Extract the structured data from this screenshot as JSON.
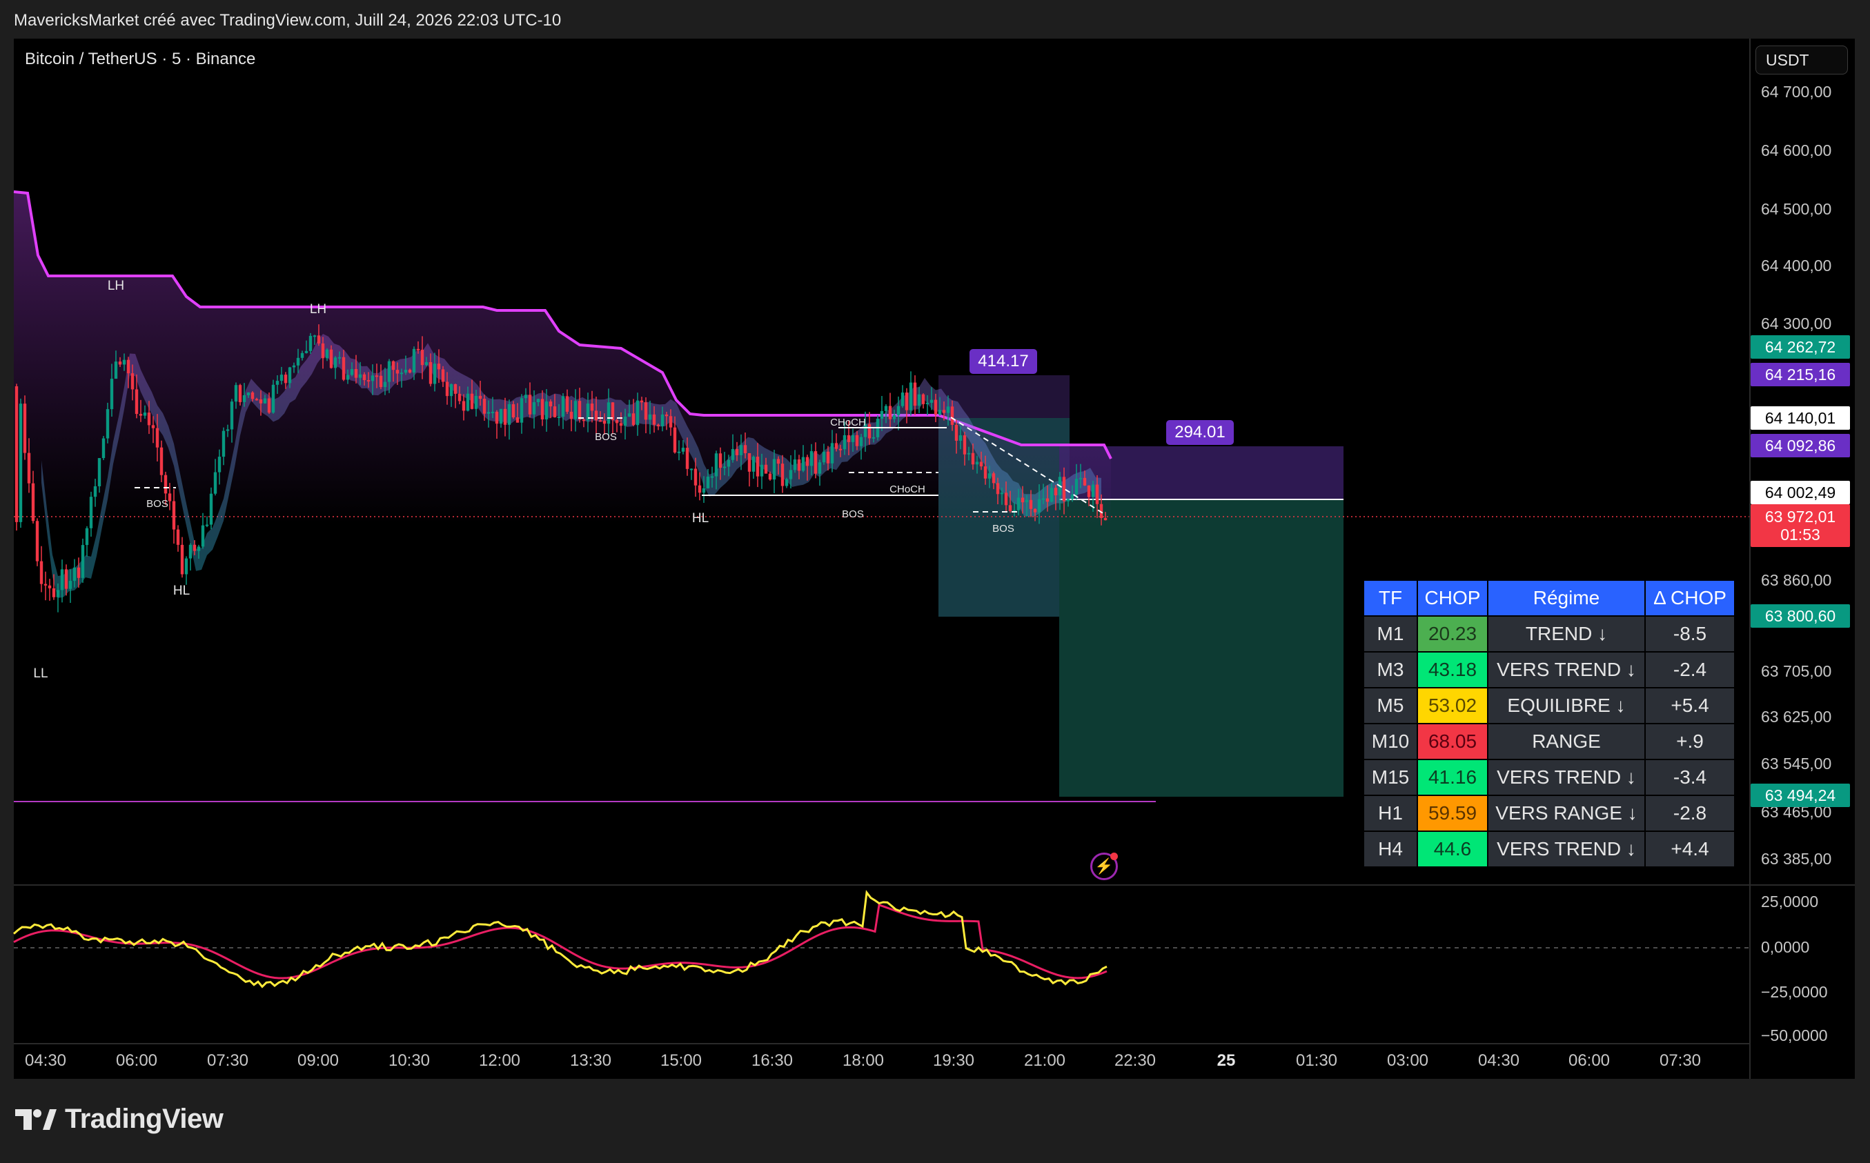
{
  "header": {
    "text": "MavericksMarket créé avec TradingView.com, Juill 24, 2026 22:03 UTC-10"
  },
  "symbol": {
    "title": "Bitcoin / TetherUS · 5 · Binance"
  },
  "currency_button": "USDT",
  "price_ticks": [
    "64 700,00",
    "64 600,00",
    "64 500,00",
    "64 400,00",
    "64 300,00",
    "63 860,00",
    "63 705,00",
    "63 625,00",
    "63 545,00",
    "63 465,00",
    "63 385,00"
  ],
  "price_labels": [
    {
      "text": "64 262,72",
      "bg": "#089981",
      "fg": "#ffffff"
    },
    {
      "text": "64 215,16",
      "bg": "#6a2fc5",
      "fg": "#ffffff"
    },
    {
      "text": "64 140,01",
      "bg": "#ffffff",
      "fg": "#000000"
    },
    {
      "text": "64 092,86",
      "bg": "#6a2fc5",
      "fg": "#ffffff"
    },
    {
      "text": "64 002,49",
      "bg": "#ffffff",
      "fg": "#000000"
    },
    {
      "text": "63 972,01",
      "sub": "01:53",
      "bg": "#f23645",
      "fg": "#ffffff"
    },
    {
      "text": "63 800,60",
      "bg": "#089981",
      "fg": "#ffffff"
    },
    {
      "text": "63 494,24",
      "bg": "#089981",
      "fg": "#ffffff"
    }
  ],
  "osc_ticks": [
    "25,0000",
    "0,0000",
    "−25,0000",
    "−50,0000"
  ],
  "time_ticks": [
    "04:30",
    "06:00",
    "07:30",
    "09:00",
    "10:30",
    "12:00",
    "13:30",
    "15:00",
    "16:30",
    "18:00",
    "19:30",
    "21:00",
    "22:30",
    "25",
    "01:30",
    "03:00",
    "04:30",
    "06:00",
    "07:30"
  ],
  "box_labels": [
    "414.17",
    "294.01"
  ],
  "smc_labels": {
    "lh1": "LH",
    "lh2": "LH",
    "hl1": "HL",
    "hl2": "HL",
    "ll": "LL",
    "bos1": "BOS",
    "bos2": "BOS",
    "bos3": "BOS",
    "bos4": "BOS",
    "choch1": "CHoCH",
    "choch2": "CHoCH"
  },
  "table": {
    "headers": [
      "TF",
      "CHOP",
      "Régime",
      "Δ CHOP"
    ],
    "rows": [
      {
        "tf": "M1",
        "chop": "20.23",
        "chop_bg": "#4caf50",
        "chop_fg": "#1b3a1b",
        "regime": "TREND ↓",
        "delta": "-8.5"
      },
      {
        "tf": "M3",
        "chop": "43.18",
        "chop_bg": "#00e676",
        "chop_fg": "#0b3d22",
        "regime": "VERS TREND ↓",
        "delta": "-2.4"
      },
      {
        "tf": "M5",
        "chop": "53.02",
        "chop_bg": "#ffd600",
        "chop_fg": "#5a4a00",
        "regime": "EQUILIBRE ↓",
        "delta": "+5.4"
      },
      {
        "tf": "M10",
        "chop": "68.05",
        "chop_bg": "#f23645",
        "chop_fg": "#5a0010",
        "regime": "RANGE",
        "delta": "+.9"
      },
      {
        "tf": "M15",
        "chop": "41.16",
        "chop_bg": "#00e676",
        "chop_fg": "#0b3d22",
        "regime": "VERS TREND ↓",
        "delta": "-3.4"
      },
      {
        "tf": "H1",
        "chop": "59.59",
        "chop_bg": "#ff9800",
        "chop_fg": "#5a3300",
        "regime": "VERS RANGE ↓",
        "delta": "-2.8"
      },
      {
        "tf": "H4",
        "chop": "44.6",
        "chop_bg": "#00e676",
        "chop_fg": "#0b3d22",
        "regime": "VERS TREND ↓",
        "delta": "+4.4"
      }
    ]
  },
  "footer": {
    "logo_text": "TradingView"
  },
  "colors": {
    "bull": "#089981",
    "bear": "#f23645",
    "purple": "#6a2fc5",
    "magenta": "#e040fb",
    "osc_fast": "#ffeb3b",
    "osc_slow": "#e91e63"
  }
}
